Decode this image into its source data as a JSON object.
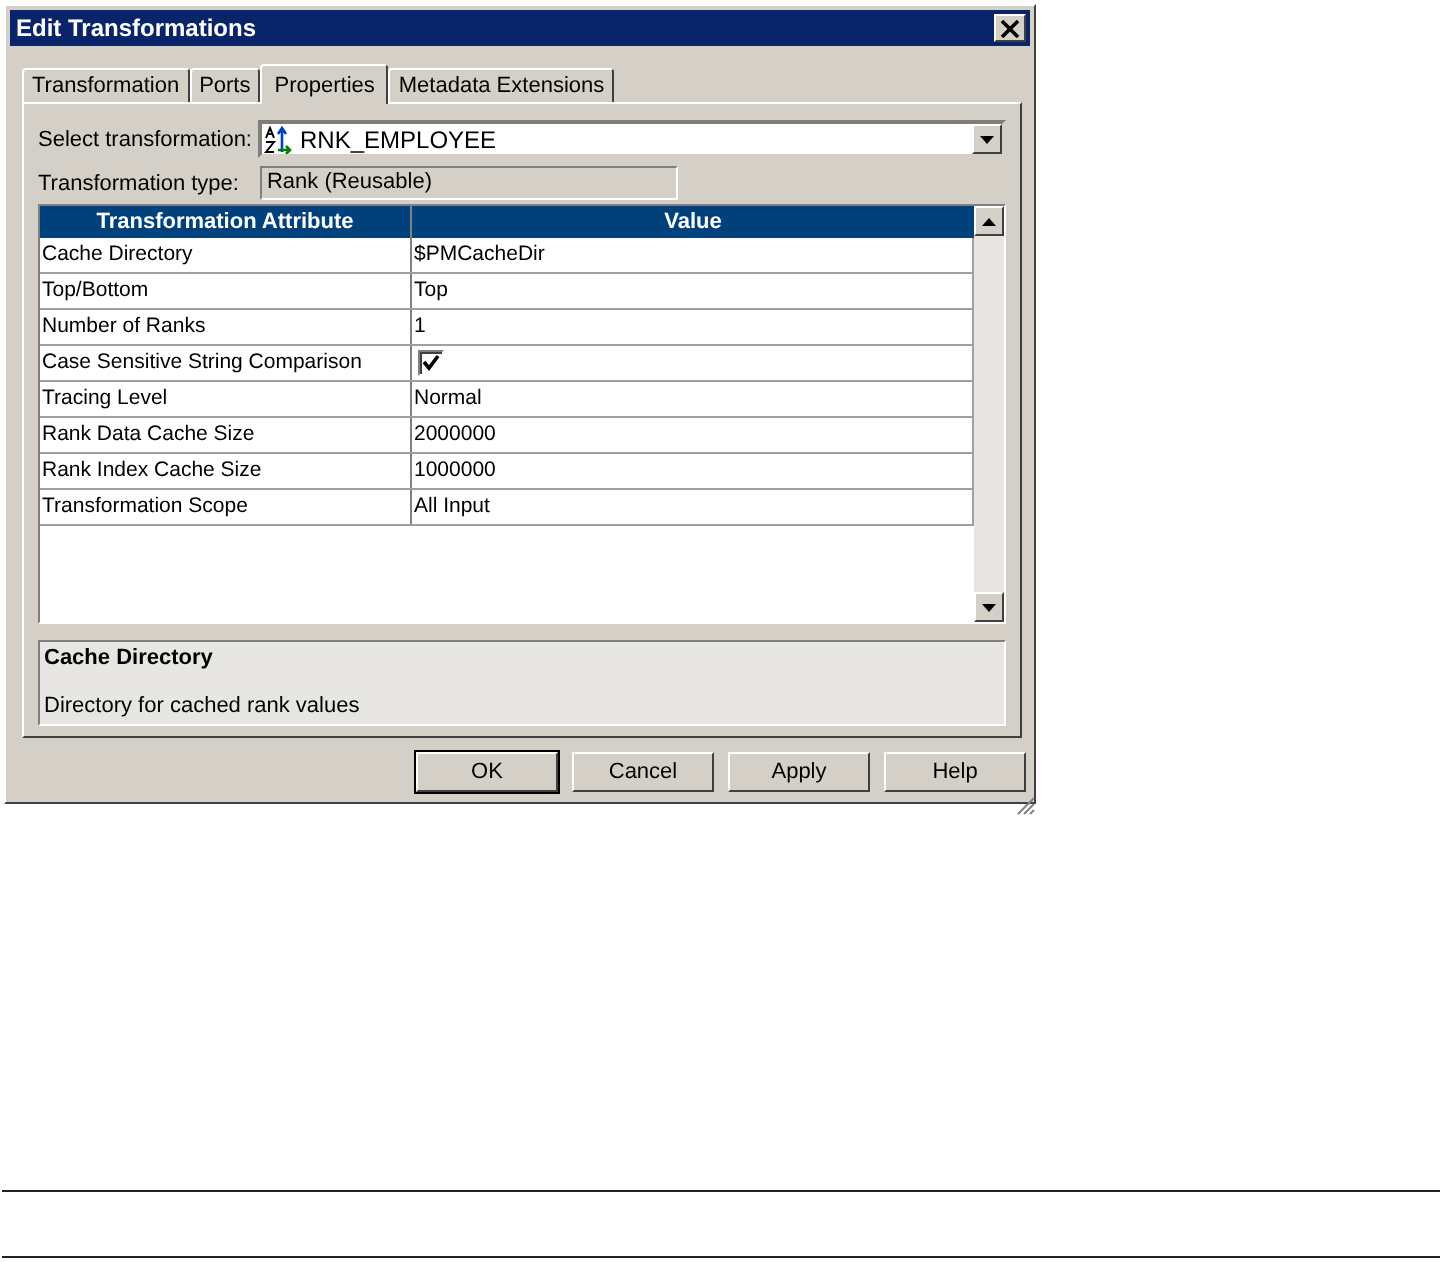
{
  "window": {
    "title": "Edit Transformations"
  },
  "tabs": [
    {
      "label": "Transformation",
      "selected": false
    },
    {
      "label": "Ports",
      "selected": false
    },
    {
      "label": "Properties",
      "selected": true
    },
    {
      "label": "Metadata Extensions",
      "selected": false
    }
  ],
  "select_transformation": {
    "label": "Select transformation:",
    "value": "RNK_EMPLOYEE"
  },
  "transformation_type": {
    "label": "Transformation type:",
    "value": "Rank (Reusable)"
  },
  "table": {
    "columns": [
      "Transformation Attribute",
      "Value"
    ],
    "rows": [
      {
        "attribute": "Cache Directory",
        "kind": "text",
        "value": "$PMCacheDir"
      },
      {
        "attribute": "Top/Bottom",
        "kind": "text",
        "value": "Top"
      },
      {
        "attribute": "Number of Ranks",
        "kind": "text",
        "value": "1"
      },
      {
        "attribute": "Case Sensitive String Comparison",
        "kind": "checkbox",
        "checked": true
      },
      {
        "attribute": "Tracing Level",
        "kind": "text",
        "value": "Normal"
      },
      {
        "attribute": "Rank Data Cache Size",
        "kind": "text",
        "value": "2000000"
      },
      {
        "attribute": "Rank Index Cache Size",
        "kind": "text",
        "value": "1000000"
      },
      {
        "attribute": "Transformation Scope",
        "kind": "text",
        "value": "All Input"
      }
    ]
  },
  "description": {
    "title": "Cache Directory",
    "text": "Directory for cached rank values"
  },
  "buttons": [
    "OK",
    "Cancel",
    "Apply",
    "Help"
  ]
}
